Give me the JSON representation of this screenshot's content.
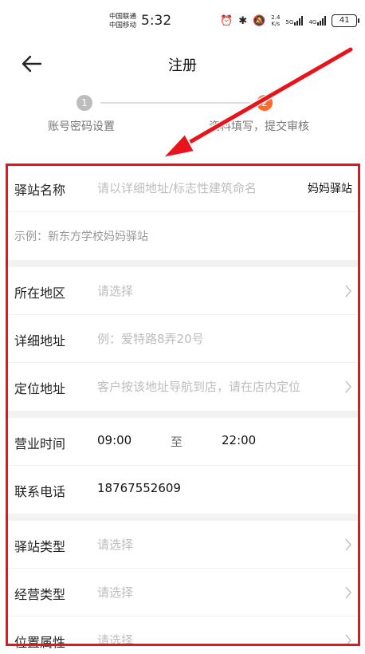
{
  "status_bar": {
    "carrier_line1": "中国联通",
    "carrier_line2": "中国移动",
    "time": "5:32",
    "alarm_icon": "alarm-icon",
    "bluetooth_icon": "bluetooth-icon",
    "mute_icon": "mute-icon",
    "speed_value": "2.4",
    "speed_unit": "K/s",
    "net_5g": "5G",
    "net_4g": "4G",
    "battery": "41"
  },
  "header": {
    "title": "注册",
    "back_icon": "back-arrow-icon"
  },
  "stepper": {
    "step1_number": "1",
    "step1_label": "账号密码设置",
    "step2_number": "2",
    "step2_label": "资料填写，提交审核"
  },
  "form": {
    "station_name": {
      "label": "驿站名称",
      "placeholder": "请以详细地址/标志性建筑命名",
      "suffix": "妈妈驿站"
    },
    "example": "示例：新东方学校妈妈驿站",
    "region": {
      "label": "所在地区",
      "placeholder": "请选择"
    },
    "address": {
      "label": "详细地址",
      "placeholder": "例：爱特路8弄20号"
    },
    "location": {
      "label": "定位地址",
      "placeholder": "客户按该地址导航到店，请在店内定位"
    },
    "hours": {
      "label": "营业时间",
      "start": "09:00",
      "separator": "至",
      "end": "22:00"
    },
    "phone": {
      "label": "联系电话",
      "value": "18767552609"
    },
    "station_type": {
      "label": "驿站类型",
      "placeholder": "请选择"
    },
    "business_type": {
      "label": "经营类型",
      "placeholder": "请选择"
    },
    "location_attr": {
      "label": "位置属性",
      "placeholder": "请选择"
    }
  },
  "colors": {
    "accent": "#ff6a2b",
    "annotation_red": "#e8131b",
    "placeholder": "#bdbdbd"
  }
}
